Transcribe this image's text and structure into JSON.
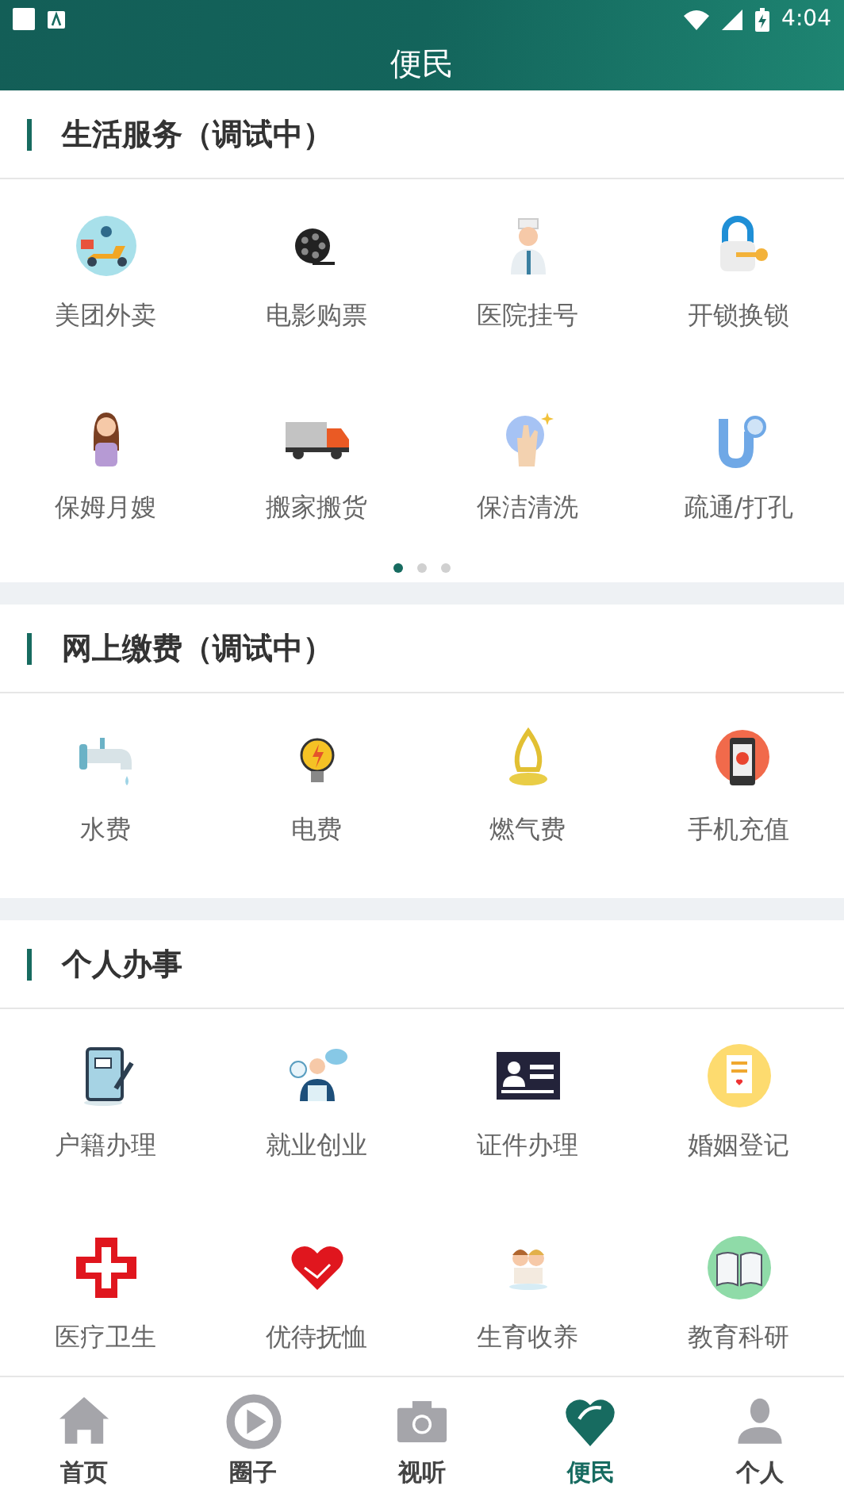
{
  "status_bar": {
    "time": "4:04"
  },
  "header": {
    "title": "便民"
  },
  "sections": [
    {
      "title": "生活服务（调试中）",
      "items": [
        {
          "label": "美团外卖"
        },
        {
          "label": "电影购票"
        },
        {
          "label": "医院挂号"
        },
        {
          "label": "开锁换锁"
        },
        {
          "label": "保姆月嫂"
        },
        {
          "label": "搬家搬货"
        },
        {
          "label": "保洁清洗"
        },
        {
          "label": "疏通/打孔"
        }
      ],
      "pager": [
        {
          "selected": true
        },
        {
          "selected": false
        },
        {
          "selected": false
        }
      ]
    },
    {
      "title": "网上缴费（调试中）",
      "items": [
        {
          "label": "水费"
        },
        {
          "label": "电费"
        },
        {
          "label": "燃气费"
        },
        {
          "label": "手机充值"
        }
      ]
    },
    {
      "title": "个人办事",
      "items": [
        {
          "label": "户籍办理"
        },
        {
          "label": "就业创业"
        },
        {
          "label": "证件办理"
        },
        {
          "label": "婚姻登记"
        },
        {
          "label": "医疗卫生"
        },
        {
          "label": "优待抚恤"
        },
        {
          "label": "生育收养"
        },
        {
          "label": "教育科研"
        }
      ]
    }
  ],
  "tab_bar": [
    {
      "label": "首页",
      "selected": false
    },
    {
      "label": "圈子",
      "selected": false
    },
    {
      "label": "视听",
      "selected": false
    },
    {
      "label": "便民",
      "selected": true
    },
    {
      "label": "个人",
      "selected": false
    }
  ]
}
